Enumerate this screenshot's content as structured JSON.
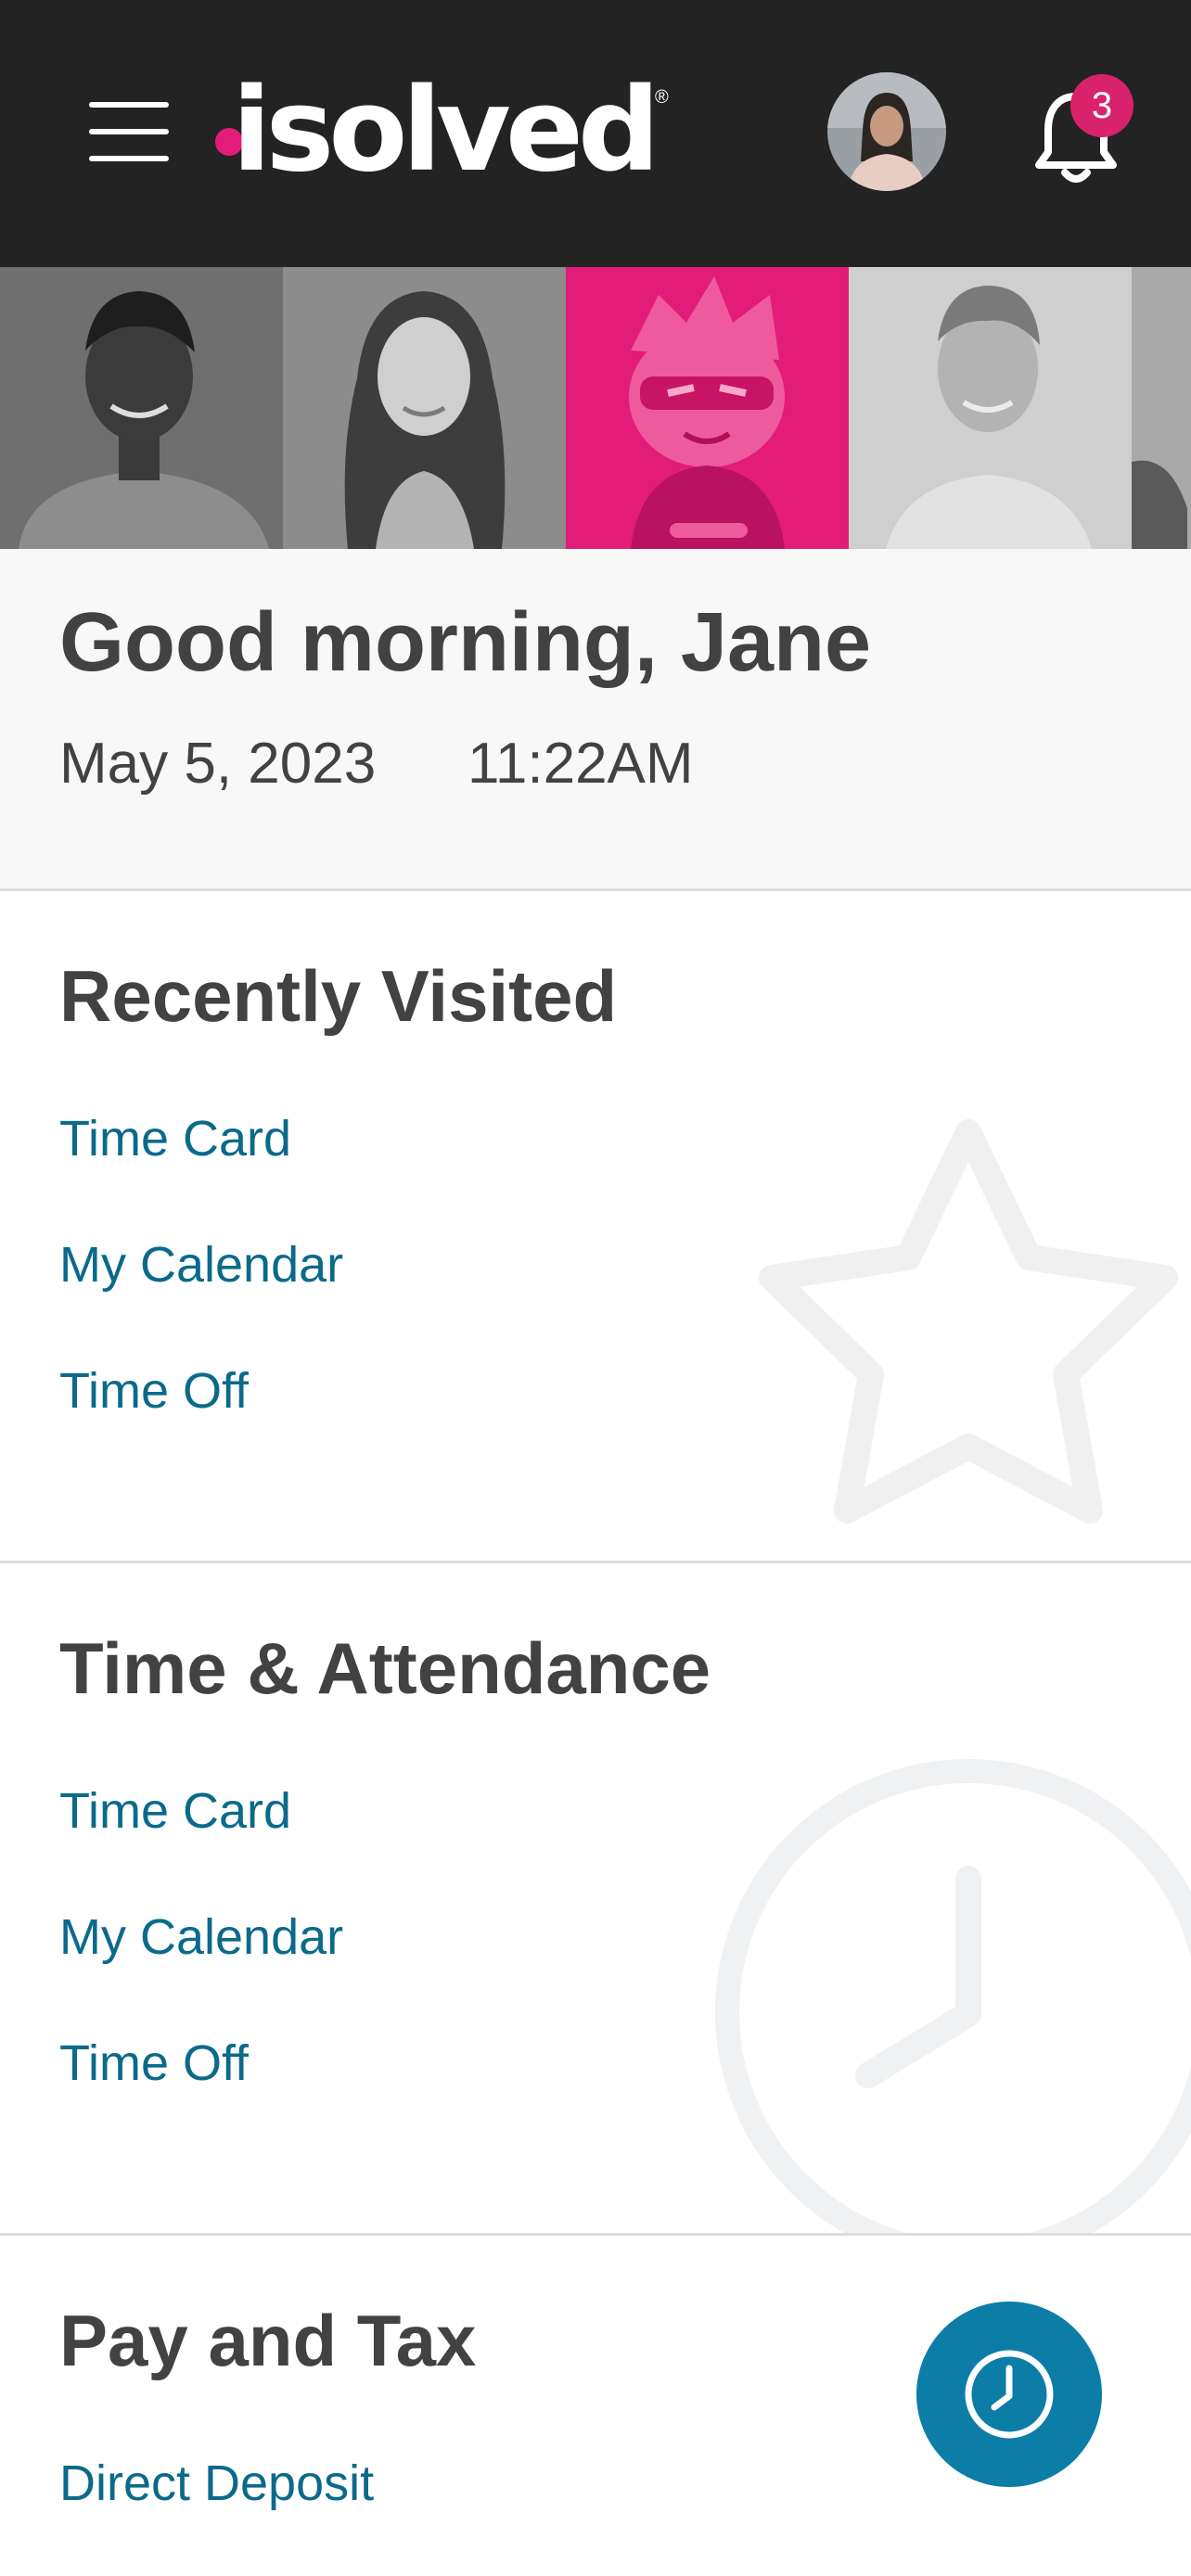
{
  "header": {
    "logo_text": "isolved",
    "logo_registered": "®",
    "logo_dot_color": "#e31c79",
    "notification_count": "3"
  },
  "banner": {
    "tiles": [
      "photo-man",
      "photo-woman",
      "mascot-hero",
      "photo-man-2",
      "photo-partial"
    ],
    "accent_color": "#e31c79"
  },
  "greeting": {
    "title": "Good morning, Jane",
    "date": "May 5, 2023",
    "time": "11:22AM"
  },
  "recently_visited": {
    "title": "Recently Visited",
    "icon": "star-icon",
    "links": [
      "Time Card",
      "My Calendar",
      "Time Off"
    ]
  },
  "time_attendance": {
    "title": "Time & Attendance",
    "icon": "clock-icon",
    "links": [
      "Time Card",
      "My Calendar",
      "Time Off"
    ]
  },
  "pay_tax": {
    "title": "Pay and Tax",
    "links": [
      "Direct Deposit"
    ]
  },
  "fab": {
    "icon": "clock-icon",
    "color": "#0b7da6"
  },
  "colors": {
    "appbar": "#232323",
    "link": "#0b6a8a",
    "heading": "#424242",
    "badge": "#d8226c"
  }
}
